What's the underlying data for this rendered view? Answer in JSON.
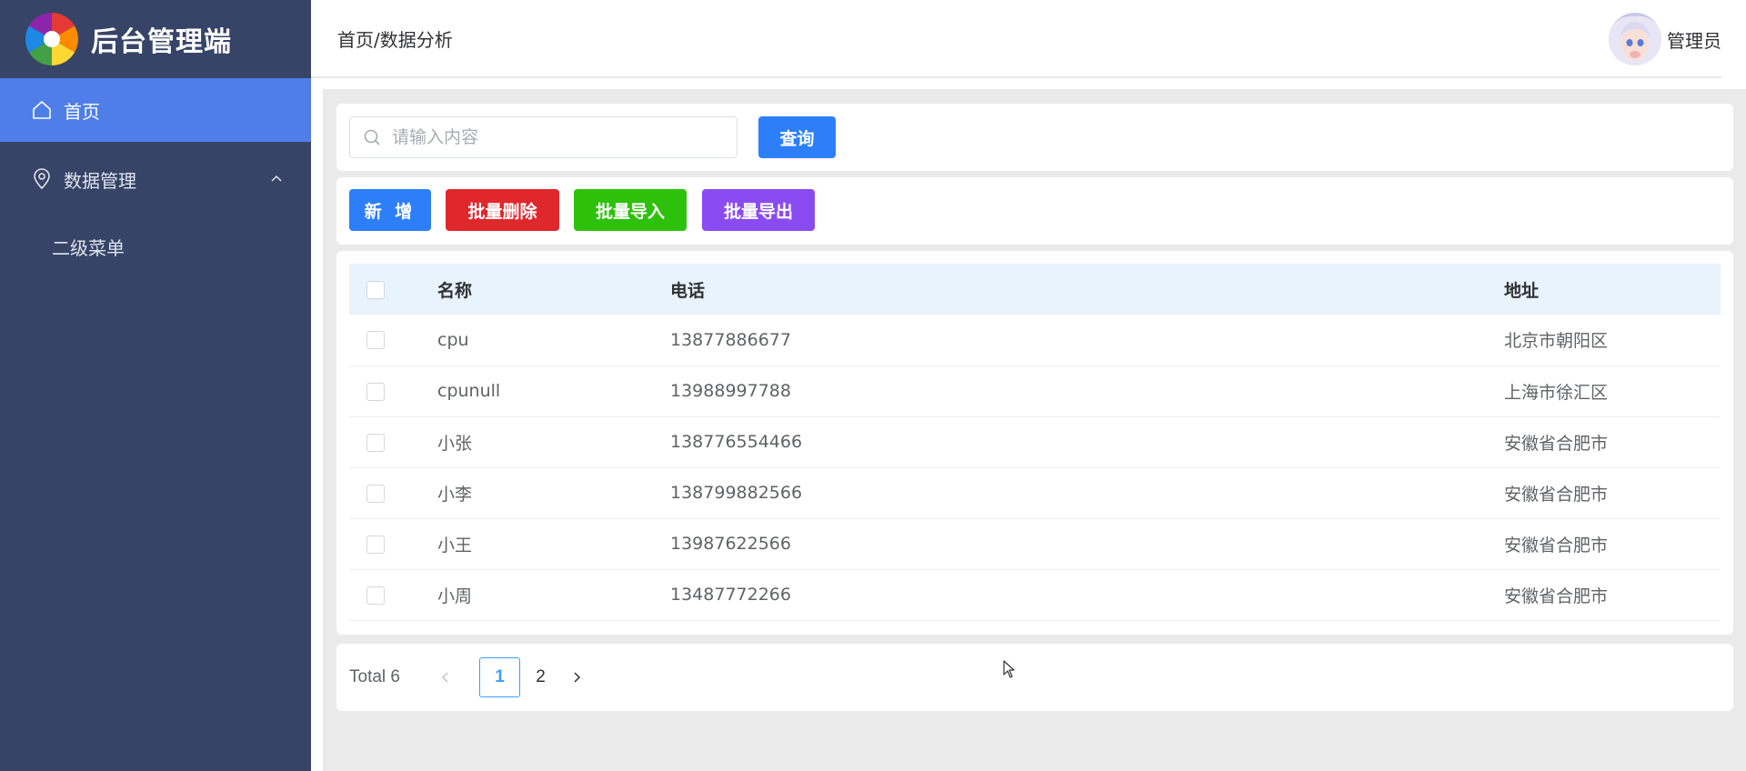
{
  "app": {
    "title": "后台管理端"
  },
  "sidebar": {
    "items": [
      {
        "label": "首页",
        "icon": "home-icon",
        "active": true
      },
      {
        "label": "数据管理",
        "icon": "location-icon",
        "expanded": true,
        "children": [
          {
            "label": "二级菜单"
          }
        ]
      }
    ]
  },
  "header": {
    "breadcrumb": "首页/数据分析",
    "user_name": "管理员"
  },
  "search": {
    "placeholder": "请输入内容",
    "value": "",
    "button_label": "查询"
  },
  "actions": {
    "add_label": "新 增",
    "batch_delete_label": "批量删除",
    "batch_import_label": "批量导入",
    "batch_export_label": "批量导出"
  },
  "table": {
    "columns": [
      "名称",
      "电话",
      "地址"
    ],
    "rows": [
      {
        "name": "cpu",
        "phone": "13877886677",
        "address": "北京市朝阳区"
      },
      {
        "name": "cpunull",
        "phone": "13988997788",
        "address": "上海市徐汇区"
      },
      {
        "name": "小张",
        "phone": "138776554466",
        "address": "安徽省合肥市"
      },
      {
        "name": "小李",
        "phone": "138799882566",
        "address": "安徽省合肥市"
      },
      {
        "name": "小王",
        "phone": "13987622566",
        "address": "安徽省合肥市"
      },
      {
        "name": "小周",
        "phone": "13487772266",
        "address": "安徽省合肥市"
      }
    ]
  },
  "pagination": {
    "total_label": "Total 6",
    "pages": [
      "1",
      "2"
    ],
    "current_page": "1"
  },
  "colors": {
    "sidebar_bg": "#374467",
    "active_menu": "#4f7ee8",
    "primary": "#2d7ff9",
    "danger": "#e0272c",
    "success": "#2ec10b",
    "purple": "#8a4cf2"
  }
}
